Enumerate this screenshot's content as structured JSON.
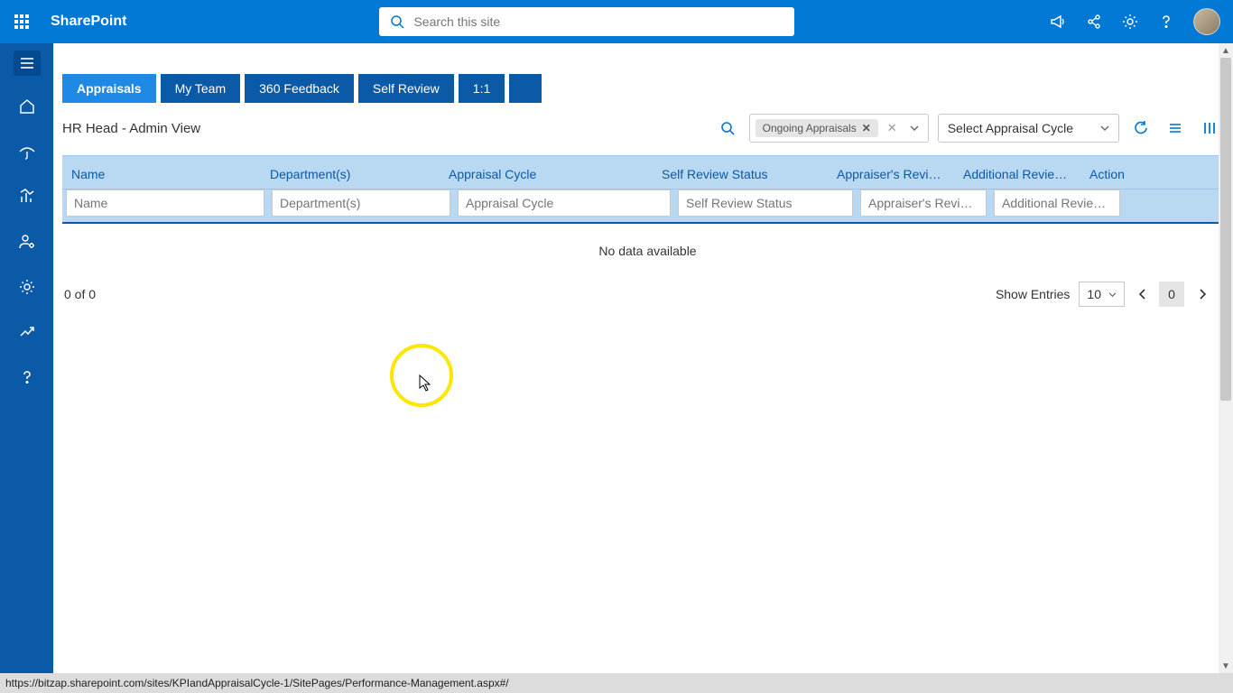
{
  "header": {
    "brand": "SharePoint",
    "search_placeholder": "Search this site"
  },
  "tabs": [
    {
      "label": "Appraisals",
      "active": true
    },
    {
      "label": "My Team"
    },
    {
      "label": "360 Feedback"
    },
    {
      "label": "Self Review"
    },
    {
      "label": "1:1"
    }
  ],
  "page": {
    "title": "HR Head - Admin View",
    "filter_chip": "Ongoing Appraisals",
    "cycle_select": "Select Appraisal Cycle"
  },
  "table": {
    "columns": [
      "Name",
      "Department(s)",
      "Appraisal Cycle",
      "Self Review Status",
      "Appraiser's Revie…",
      "Additional Revie…",
      "Action"
    ],
    "filters": [
      "Name",
      "Department(s)",
      "Appraisal Cycle",
      "Self Review Status",
      "Appraiser's Revie…",
      "Additional Revie…"
    ],
    "empty_text": "No data available"
  },
  "pager": {
    "range": "0 of 0",
    "show_label": "Show Entries",
    "page_size": "10",
    "current": "0"
  },
  "status": {
    "url": "https://bitzap.sharepoint.com/sites/KPIandAppraisalCycle-1/SitePages/Performance-Management.aspx#/"
  }
}
